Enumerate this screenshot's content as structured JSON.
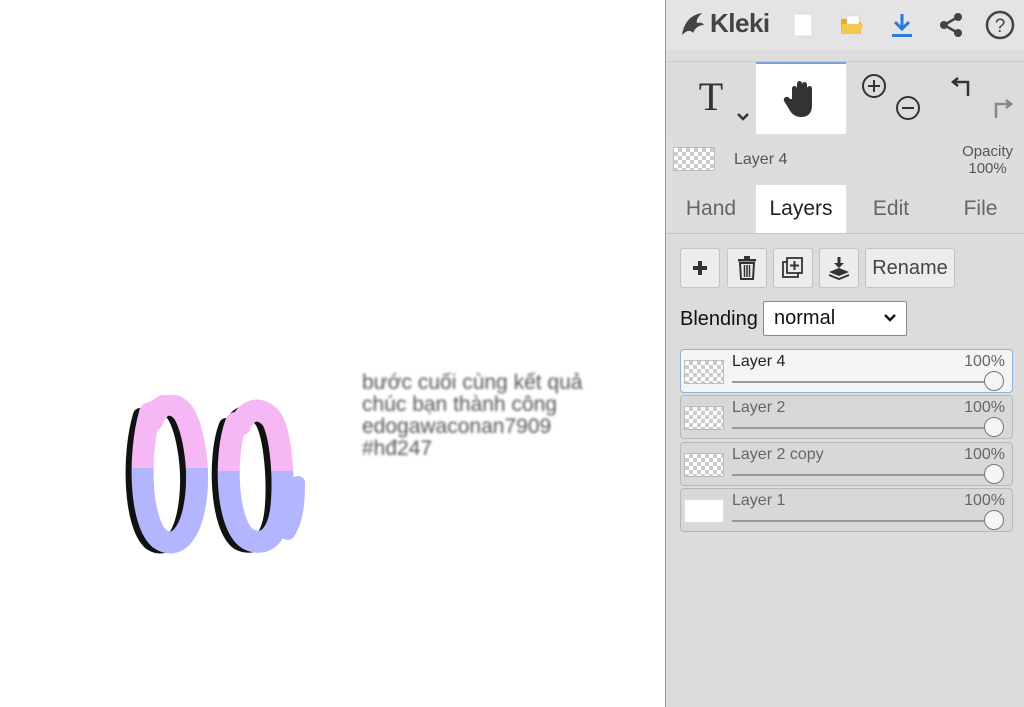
{
  "app": {
    "name": "Kleki"
  },
  "canvas": {
    "text_lines": [
      "bước cuối cùng kết quả",
      "chúc bạn thành công",
      "edogawaconan7909",
      "#hđ247"
    ]
  },
  "topbar": {
    "icons": [
      "new-document-icon",
      "open-folder-icon",
      "download-icon",
      "share-icon",
      "help-icon"
    ],
    "help_label": "?"
  },
  "tools": {
    "text_tool_label": "T",
    "active": "hand"
  },
  "current_layer": {
    "name": "Layer 4",
    "opacity_label": "Opacity",
    "opacity_value": "100%"
  },
  "tabs": [
    "Hand",
    "Layers",
    "Edit",
    "File"
  ],
  "layers_panel": {
    "rename_label": "Rename",
    "blending_label": "Blending",
    "blending_value": "normal",
    "layers": [
      {
        "name": "Layer 4",
        "opacity": "100%",
        "opacity_fraction": 1.0,
        "active": true
      },
      {
        "name": "Layer 2",
        "opacity": "100%",
        "opacity_fraction": 1.0,
        "active": false
      },
      {
        "name": "Layer 2 copy",
        "opacity": "100%",
        "opacity_fraction": 1.0,
        "active": false
      },
      {
        "name": "Layer 1",
        "opacity": "100%",
        "opacity_fraction": 1.0,
        "active": false
      }
    ]
  },
  "colors": {
    "accent": "#2a7ad9",
    "folder": "#f0c24a",
    "art_pink": "#f5b8f5",
    "art_blue": "#b3b6ff"
  }
}
